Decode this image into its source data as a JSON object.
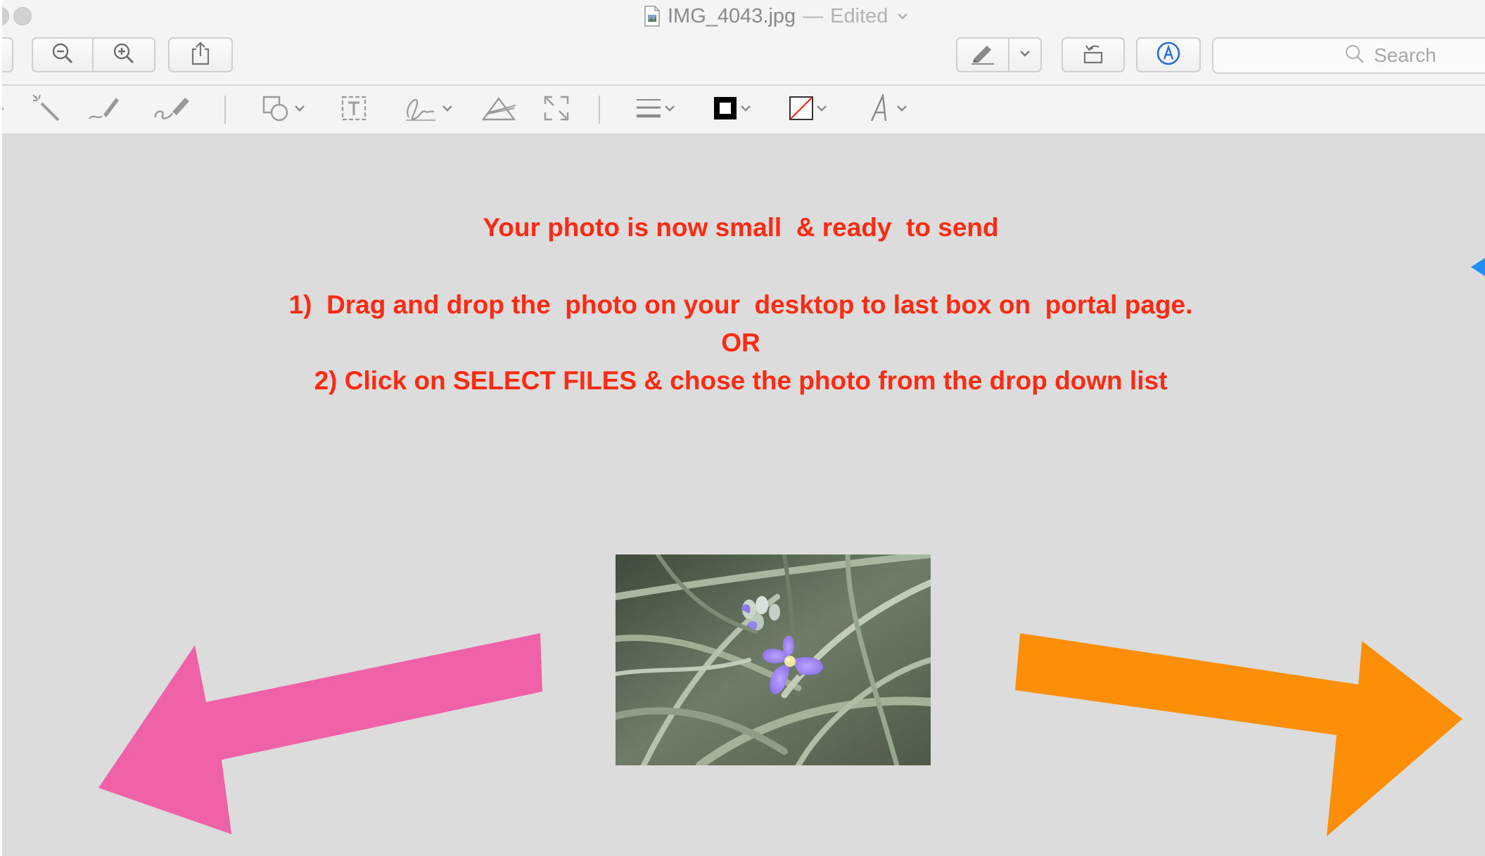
{
  "window": {
    "file_name": "IMG_4043.jpg",
    "separator": "—",
    "status": "Edited"
  },
  "toolbar": {
    "search_placeholder": "Search"
  },
  "content": {
    "headline": "Your photo is now small  & ready  to send",
    "step1": "1)  Drag and drop the  photo on your  desktop to last box on  portal page.",
    "or": "OR",
    "step2": "2) Click on SELECT FILES & chose the photo from the drop down list",
    "text_color": "#ff2a12"
  },
  "arrows": {
    "left_color": "#f062a8",
    "right_color": "#fc8f07",
    "edge_marker_color": "#1e90ff"
  },
  "icons": {
    "zoom_out": "zoom-out-icon",
    "zoom_in": "zoom-in-icon",
    "share": "share-icon",
    "highlight": "highlighter-icon",
    "rotate": "rotate-icon",
    "markup": "markup-icon",
    "search": "search-icon"
  }
}
